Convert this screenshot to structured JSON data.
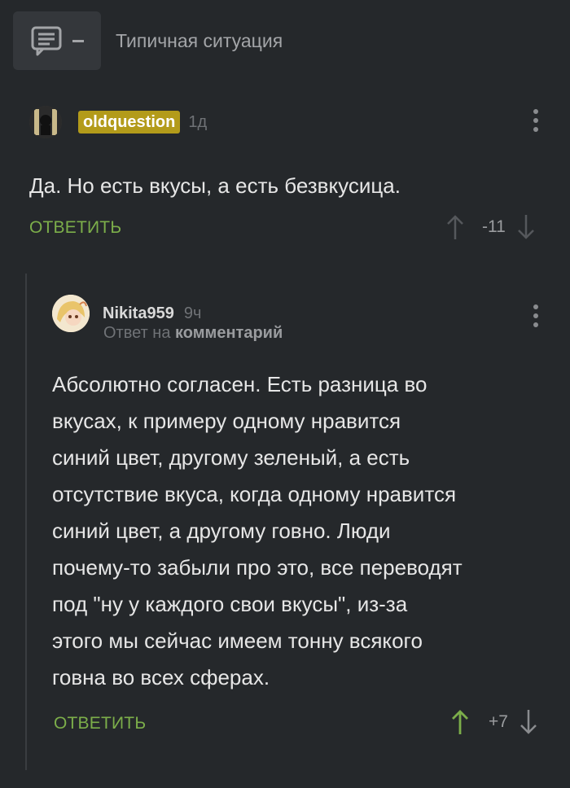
{
  "post": {
    "title": "Типичная ситуация"
  },
  "comment1": {
    "username": "oldquestion",
    "time": "1д",
    "text": "Да. Но есть вкусы, а есть безвкусица.",
    "reply_label": "ОТВЕТИТЬ",
    "score": "-11"
  },
  "comment2": {
    "username": "Nikita959",
    "time": "9ч",
    "reply_prefix": "Ответ на",
    "reply_target": "комментарий",
    "text_lines": [
      "Абсолютно согласен. Есть разница во",
      "вкусах, к примеру одному нравится",
      "синий цвет, другому зеленый, а есть",
      "отсутствие вкуса, когда одному нравится",
      "синий цвет, а другому говно. Люди",
      "почему-то забыли про это, все переводят",
      "под \"ну у каждого свои вкусы\", из-за",
      "этого мы сейчас имеем тонну всякого",
      "говна во всех сферах."
    ],
    "reply_label": "ОТВЕТИТЬ",
    "score": "+7"
  },
  "colors": {
    "accent_green": "#7cae4a",
    "user_tag": "#b39b1a",
    "background": "#25282b"
  }
}
